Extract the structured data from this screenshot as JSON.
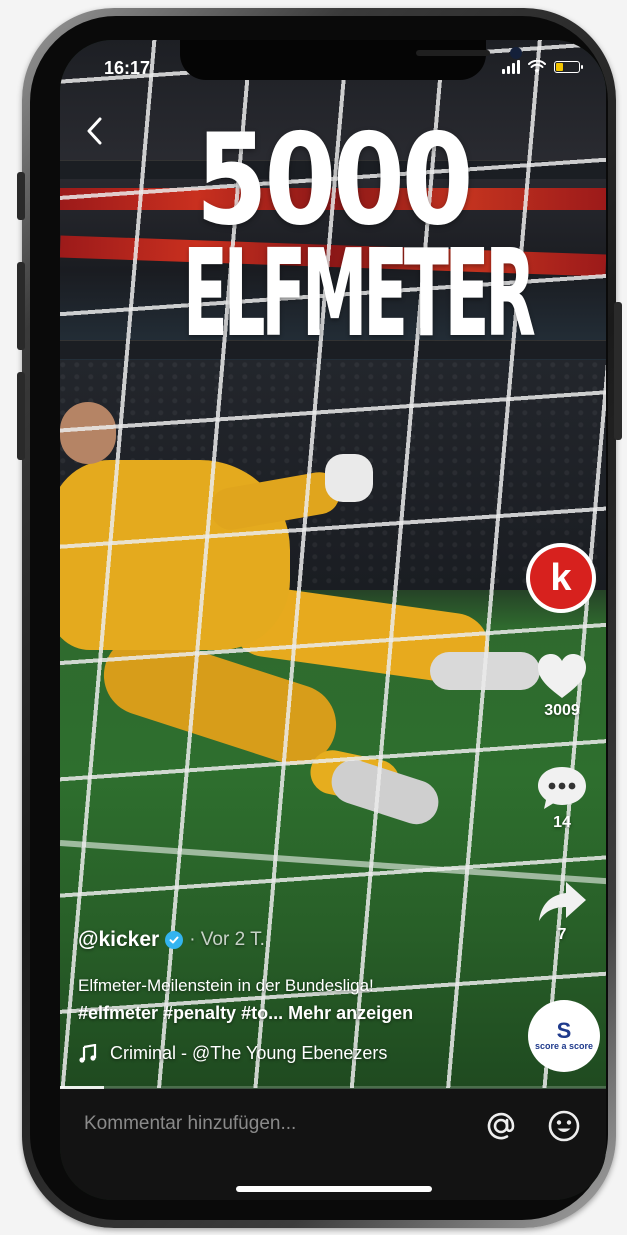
{
  "status_bar": {
    "time": "16:17",
    "battery_color": "#f2c400"
  },
  "video": {
    "headline_number": "5000",
    "headline_word": "ELFMETER",
    "progress_fraction": 0.08
  },
  "rail": {
    "avatar_letter": "k",
    "avatar_color": "#d7211e",
    "likes": "3009",
    "comments": "14",
    "shares": "7",
    "sound_disc_letter": "S",
    "sound_disc_text": "score a score"
  },
  "caption": {
    "username": "@kicker",
    "time_ago": "· Vor 2 T.",
    "description": "Elfmeter-Meilenstein in der Bundesliga!",
    "hashtags": "#elfmeter #penalty #to... Mehr anzeigen",
    "music": "Criminal - @The Young Ebenezers"
  },
  "comment_bar": {
    "placeholder": "Kommentar hinzufügen..."
  },
  "icons": {
    "back": "chevron-left-icon",
    "like": "heart-icon",
    "comment": "speech-bubble-icon",
    "share": "share-arrow-icon",
    "music": "music-note-icon",
    "mention": "at-sign-icon",
    "emoji": "smiley-icon"
  }
}
